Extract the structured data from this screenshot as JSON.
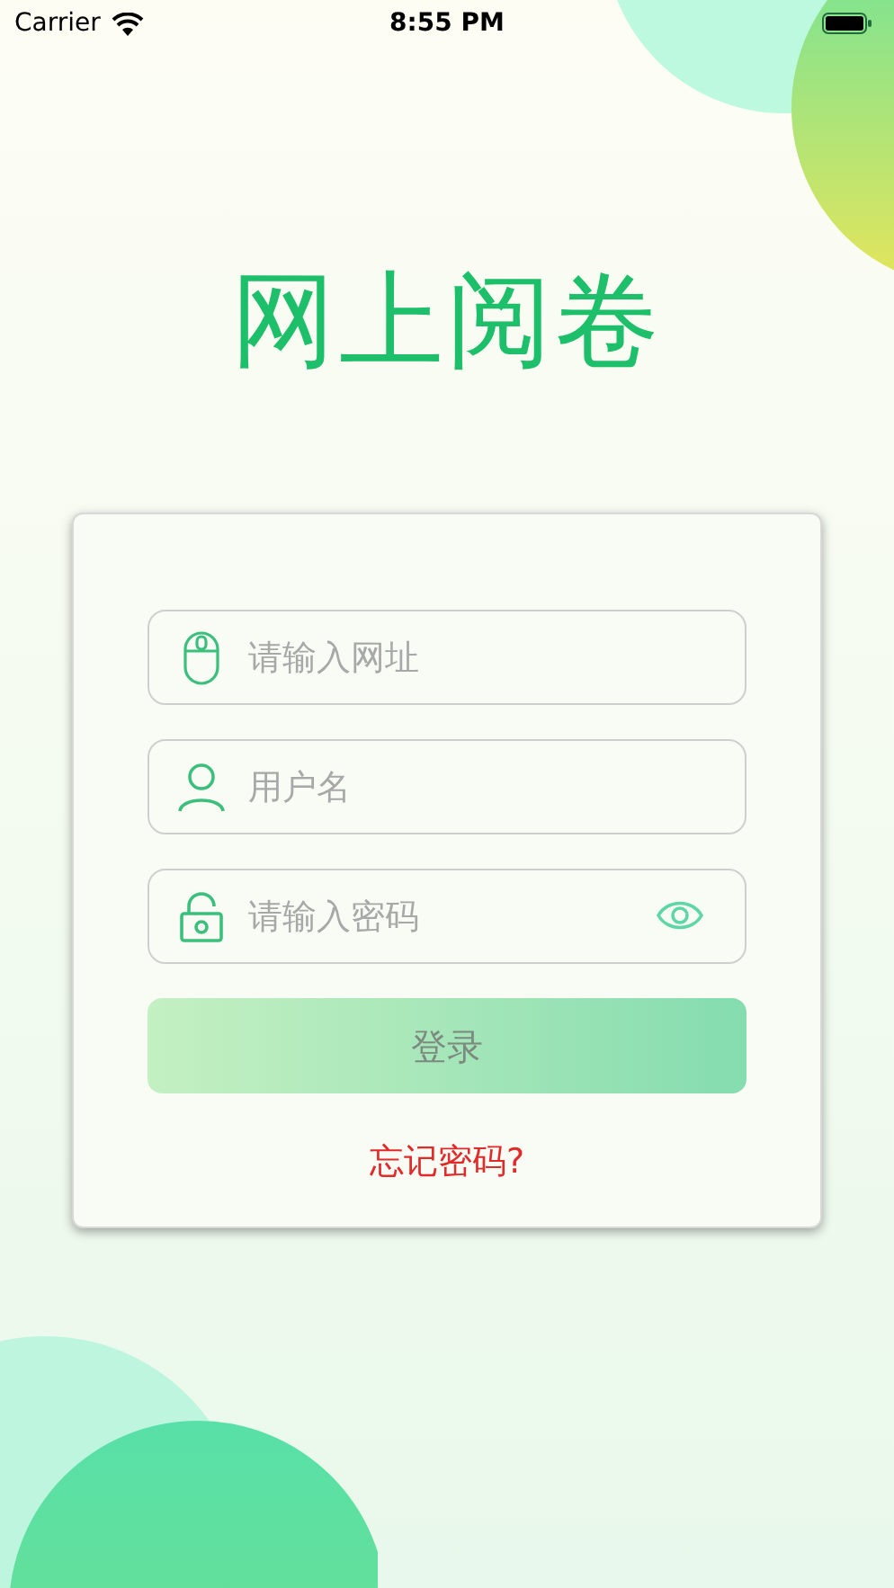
{
  "status_bar": {
    "carrier": "Carrier",
    "time": "8:55 PM"
  },
  "title": "网上阅卷",
  "fields": [
    {
      "kind": "url",
      "placeholder": "请输入网址"
    },
    {
      "kind": "user",
      "placeholder": "用户名"
    },
    {
      "kind": "password",
      "placeholder": "请输入密码",
      "reveal_icon": true
    }
  ],
  "login_button": {
    "label": "登录",
    "disabled": true
  },
  "forgot_link": "忘记密码?"
}
